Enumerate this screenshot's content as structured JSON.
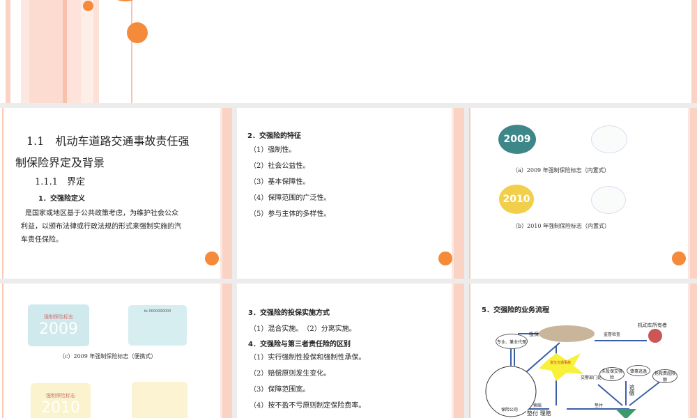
{
  "slides": [
    {
      "title_line1": "1.1　机动车道路交通事故责任强",
      "title_line2": "制保险界定及背景",
      "subtitle": "1.1.1　界定",
      "heading": "1．交强险定义",
      "body": [
        "是国家或地区基于公共政策考虑，为维护社会公众",
        "利益，以颁布法律或行政法规的形式来强制实施的汽",
        "车责任保险。"
      ]
    },
    {
      "heading": "2．交强险的特征",
      "items": [
        "（1）强制性。",
        "（2）社会公益性。",
        "（3）基本保障性。",
        "（4）保障范围的广泛性。",
        "（5）参与主体的多样性。"
      ]
    },
    {
      "caption_a": "（a）2009 年强制保险标志（内置式）",
      "caption_b": "（b）2010 年强制保险标志（内置式）",
      "badge_a": "2009",
      "badge_b": "2010"
    },
    {
      "caption_c": "（c）2009 年强制保险标志（便携式）",
      "card_title": "强制保险标志",
      "card_year_a": "2009",
      "card_year_b": "2010",
      "card_no": "№ 0000000000"
    },
    {
      "heading3": "3．交强险的投保实施方式",
      "line3": "（1）混合实施。　（2）分离实施。",
      "heading4": "4．交强险与第三者责任险的区别",
      "items": [
        "（1）实行强制性投保和强制性承保。",
        "（2）赔偿原则发生变化。",
        "（3）保障范围宽。",
        "（4）按不盈不亏原则制定保险费率。"
      ]
    },
    {
      "heading": "5．交强险的业务流程",
      "labels": {
        "agent": "专业、兼业代理",
        "insure": "投保",
        "supervise": "监督检查",
        "owner": "机动车所有者",
        "accident": "发生交通事故",
        "police": "交警部门处理",
        "company": "保险公司",
        "claim": "索赔",
        "pay": "垫付 理赔",
        "advance": "垫付",
        "n1": "未投保交强险",
        "n2": "肇事逃逸",
        "n3": "抢救费超限额",
        "recover": "追偿"
      }
    }
  ],
  "colors": {
    "accent": "#f58a3a",
    "stripe": "#f9c9b6"
  }
}
